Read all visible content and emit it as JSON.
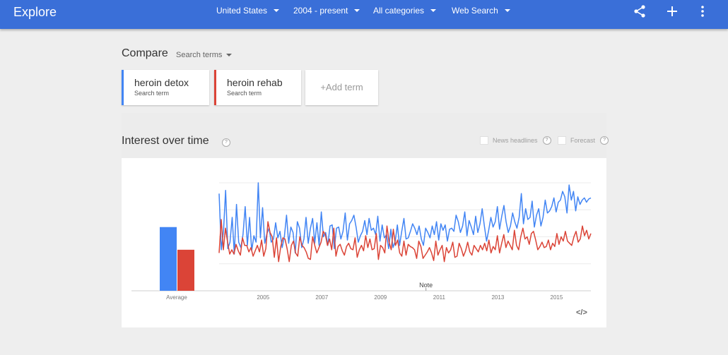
{
  "header": {
    "title": "Explore",
    "filters": [
      {
        "label": "United States"
      },
      {
        "label": "2004 - present"
      },
      {
        "label": "All categories"
      },
      {
        "label": "Web Search"
      }
    ],
    "icons": [
      "share-icon",
      "add-icon",
      "more-vert-icon"
    ],
    "bar_color": "#3a6fd8"
  },
  "compare": {
    "title": "Compare",
    "search_terms_label": "Search terms",
    "terms": [
      {
        "name": "heroin detox",
        "type": "Search term",
        "color": "#4285f4"
      },
      {
        "name": "heroin rehab",
        "type": "Search term",
        "color": "#db4437"
      }
    ],
    "add_term": "+Add term"
  },
  "interest": {
    "title": "Interest over time",
    "help": "?",
    "news_headlines": "News headlines",
    "forecast": "Forecast",
    "embed": "</>"
  },
  "chart_data": {
    "type": "line",
    "average_label": "Average",
    "note_label": "Note",
    "note_year": 2011,
    "x_ticks": [
      "2005",
      "2007",
      "2009",
      "2011",
      "2013",
      "2015"
    ],
    "x_range": [
      2004.0,
      2016.67
    ],
    "ylim": [
      0,
      100
    ],
    "grid": true,
    "averages": [
      {
        "term": "heroin detox",
        "value": 59
      },
      {
        "term": "heroin rehab",
        "value": 38
      }
    ],
    "series": [
      {
        "name": "heroin detox",
        "color": "#4285f4",
        "values": [
          90,
          38,
          55,
          93,
          39,
          45,
          68,
          34,
          80,
          45,
          40,
          52,
          78,
          42,
          68,
          37,
          51,
          45,
          100,
          49,
          77,
          44,
          53,
          58,
          45,
          48,
          63,
          49,
          55,
          40,
          50,
          70,
          44,
          59,
          54,
          35,
          64,
          58,
          40,
          48,
          68,
          44,
          58,
          67,
          44,
          63,
          42,
          73,
          50,
          54,
          42,
          60,
          61,
          39,
          58,
          59,
          48,
          55,
          72,
          47,
          62,
          65,
          70,
          59,
          45,
          51,
          55,
          65,
          52,
          67,
          56,
          58,
          52,
          69,
          46,
          61,
          49,
          52,
          39,
          57,
          40,
          46,
          61,
          42,
          55,
          67,
          48,
          49,
          55,
          62,
          58,
          52,
          60,
          48,
          42,
          58,
          54,
          49,
          60,
          52,
          64,
          47,
          62,
          56,
          61,
          46,
          57,
          58,
          55,
          70,
          64,
          54,
          60,
          73,
          51,
          65,
          59,
          52,
          69,
          54,
          62,
          76,
          60,
          46,
          56,
          68,
          59,
          64,
          78,
          57,
          69,
          79,
          64,
          54,
          60,
          72,
          64,
          58,
          68,
          90,
          62,
          76,
          66,
          68,
          83,
          59,
          70,
          76,
          60,
          68,
          84,
          72,
          74,
          78,
          86,
          73,
          82,
          84,
          92,
          87,
          72,
          98,
          84,
          92,
          74,
          87,
          80,
          84,
          86,
          82,
          85,
          86
        ]
      },
      {
        "name": "heroin rehab",
        "color": "#db4437",
        "values": [
          35,
          66,
          38,
          58,
          45,
          34,
          38,
          34,
          43,
          37,
          33,
          49,
          42,
          42,
          36,
          40,
          32,
          37,
          42,
          36,
          47,
          32,
          39,
          64,
          54,
          50,
          31,
          49,
          27,
          41,
          49,
          48,
          39,
          27,
          42,
          46,
          35,
          32,
          50,
          42,
          40,
          36,
          30,
          29,
          50,
          42,
          35,
          40,
          45,
          55,
          52,
          42,
          48,
          38,
          58,
          32,
          41,
          43,
          37,
          33,
          41,
          44,
          39,
          38,
          49,
          31,
          38,
          42,
          37,
          51,
          40,
          48,
          38,
          39,
          53,
          29,
          42,
          40,
          35,
          60,
          45,
          38,
          57,
          42,
          47,
          35,
          32,
          46,
          33,
          43,
          41,
          40,
          38,
          30,
          46,
          41,
          30,
          33,
          36,
          40,
          35,
          28,
          46,
          33,
          38,
          42,
          27,
          40,
          35,
          38,
          45,
          31,
          32,
          44,
          39,
          32,
          37,
          45,
          36,
          33,
          42,
          39,
          36,
          42,
          38,
          44,
          37,
          47,
          35,
          41,
          38,
          51,
          35,
          44,
          52,
          40,
          46,
          42,
          38,
          56,
          42,
          38,
          50,
          58,
          48,
          50,
          43,
          53,
          55,
          47,
          38,
          41,
          45,
          40,
          41,
          47,
          38,
          44,
          41,
          53,
          43,
          50,
          46,
          55,
          46,
          44,
          42,
          50,
          55,
          45,
          48,
          60,
          51,
          56,
          48,
          53
        ]
      }
    ]
  }
}
